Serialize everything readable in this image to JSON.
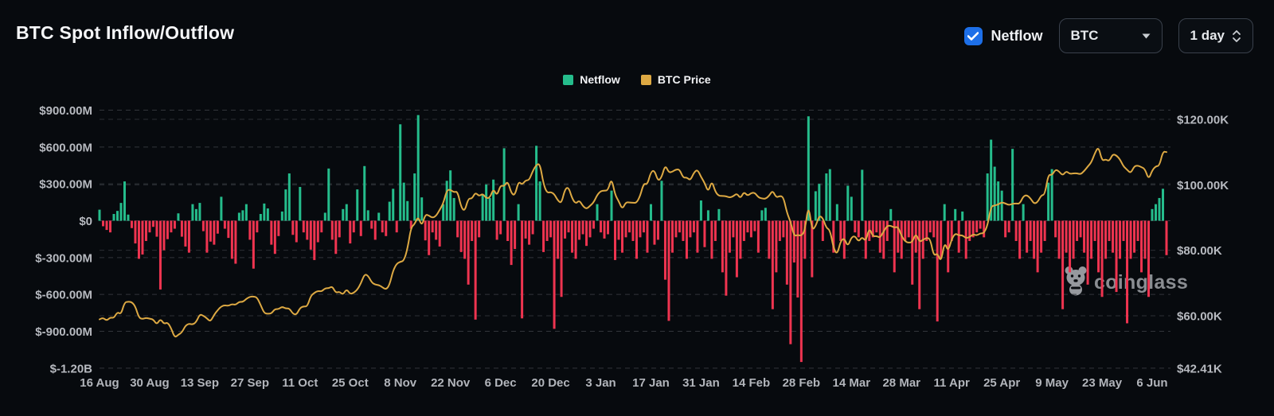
{
  "header": {
    "title": "BTC Spot Inflow/Outflow"
  },
  "controls": {
    "netflow_checkbox": {
      "label": "Netflow",
      "checked": true,
      "color": "#1d6fe8"
    },
    "coin_select": {
      "value": "BTC"
    },
    "interval_select": {
      "value": "1 day"
    }
  },
  "legend": [
    {
      "label": "Netflow",
      "color": "#25bd8c"
    },
    {
      "label": "BTC Price",
      "color": "#dda943"
    }
  ],
  "watermark": {
    "text": "coinglass"
  },
  "chart_data": {
    "type": "bar",
    "title": "BTC Spot Inflow/Outflow",
    "grid": "dashed",
    "x_tick_labels": [
      "16 Aug",
      "30 Aug",
      "13 Sep",
      "27 Sep",
      "11 Oct",
      "25 Oct",
      "8 Nov",
      "22 Nov",
      "6 Dec",
      "20 Dec",
      "3 Jan",
      "17 Jan",
      "31 Jan",
      "14 Feb",
      "28 Feb",
      "14 Mar",
      "28 Mar",
      "11 Apr",
      "25 Apr",
      "9 May",
      "23 May",
      "6 Jun"
    ],
    "x_tick_indices": [
      0,
      14,
      28,
      42,
      56,
      70,
      84,
      98,
      112,
      126,
      140,
      154,
      168,
      182,
      196,
      210,
      224,
      238,
      252,
      266,
      280,
      294
    ],
    "left_axis": {
      "title": "Netflow",
      "unit": "$M",
      "tick_labels": [
        "$900.00M",
        "$600.00M",
        "$300.00M",
        "$0",
        "$-300.00M",
        "$-600.00M",
        "$-900.00M",
        "$-1.20B"
      ],
      "tick_values": [
        900,
        600,
        300,
        0,
        -300,
        -600,
        -900,
        -1200
      ]
    },
    "right_axis": {
      "title": "BTC Price",
      "unit": "$K",
      "tick_labels": [
        "$120.00K",
        "$100.00K",
        "$80.00K",
        "$60.00K",
        "$42.41K"
      ],
      "tick_values": [
        120,
        100,
        80,
        60,
        42.41
      ]
    },
    "series": [
      {
        "name": "Netflow",
        "type": "bar",
        "axis": "left",
        "unit": "$M",
        "color_positive": "#25bd8c",
        "color_negative": "#ef3450",
        "values": [
          90,
          -45,
          -75,
          -95,
          55,
          80,
          145,
          320,
          50,
          -60,
          -185,
          -310,
          -275,
          -165,
          -95,
          -50,
          -130,
          -560,
          -240,
          -150,
          -95,
          -65,
          60,
          -130,
          -210,
          -260,
          135,
          95,
          145,
          -85,
          -260,
          -170,
          -195,
          -105,
          195,
          -65,
          -140,
          -310,
          -350,
          65,
          85,
          135,
          -155,
          -390,
          -95,
          55,
          140,
          100,
          -195,
          -270,
          -125,
          75,
          255,
          385,
          -115,
          -175,
          275,
          -95,
          -155,
          -235,
          -320,
          -175,
          -95,
          65,
          425,
          -155,
          -270,
          -135,
          95,
          135,
          -185,
          -95,
          255,
          -125,
          445,
          85,
          -65,
          -155,
          65,
          -95,
          -125,
          155,
          260,
          -95,
          785,
          310,
          160,
          -65,
          385,
          860,
          190,
          -160,
          -280,
          -95,
          -155,
          -210,
          135,
          325,
          410,
          185,
          -135,
          -255,
          -310,
          -520,
          -165,
          -805,
          -135,
          210,
          295,
          185,
          335,
          -155,
          -110,
          590,
          -165,
          -360,
          -230,
          135,
          -795,
          -145,
          -195,
          -110,
          610,
          320,
          -255,
          -165,
          -135,
          -880,
          -310,
          -620,
          -145,
          -95,
          -260,
          -310,
          -155,
          -110,
          -205,
          -135,
          -65,
          135,
          -95,
          -145,
          -110,
          245,
          -320,
          -155,
          -260,
          -135,
          -95,
          -165,
          -310,
          -135,
          -95,
          -260,
          135,
          -195,
          -155,
          325,
          -480,
          -815,
          -260,
          -135,
          -95,
          -165,
          -310,
          -135,
          -95,
          -260,
          165,
          -215,
          85,
          -310,
          -165,
          95,
          -420,
          -610,
          -260,
          -135,
          -460,
          -310,
          -165,
          -95,
          -135,
          -85,
          -260,
          85,
          105,
          -310,
          -720,
          -420,
          -165,
          -135,
          -520,
          -1005,
          -340,
          -625,
          -1150,
          -310,
          850,
          -460,
          240,
          300,
          -165,
          385,
          420,
          -260,
          135,
          -165,
          -310,
          285,
          195,
          -95,
          -135,
          415,
          -310,
          -165,
          -135,
          -95,
          -260,
          -310,
          -165,
          95,
          -420,
          -260,
          -310,
          -165,
          -135,
          -520,
          -260,
          -720,
          -310,
          -165,
          -95,
          -135,
          -820,
          -310,
          135,
          -420,
          -165,
          95,
          -260,
          75,
          -310,
          -165,
          -135,
          -95,
          -65,
          -135,
          385,
          660,
          440,
          320,
          245,
          -135,
          -95,
          585,
          -165,
          -310,
          135,
          -260,
          -165,
          -310,
          -420,
          -260,
          -165,
          310,
          420,
          -135,
          -310,
          -720,
          -260,
          -420,
          -310,
          -165,
          -135,
          -260,
          -520,
          -310,
          -165,
          -420,
          -620,
          -310,
          -165,
          -260,
          -580,
          -310,
          -165,
          -835,
          -310,
          -260,
          -165,
          -420,
          -310,
          -620,
          95,
          135,
          185,
          260,
          -280
        ]
      },
      {
        "name": "BTC Price",
        "type": "line",
        "axis": "right",
        "unit": "$K",
        "color": "#dda943",
        "values": [
          58.9,
          59.4,
          58.5,
          59.5,
          59.3,
          61.2,
          60.4,
          64.1,
          64.3,
          64.2,
          62.9,
          59.4,
          59.0,
          59.4,
          59.1,
          58.9,
          57.3,
          59.1,
          57.5,
          58.0,
          56.2,
          53.3,
          54.2,
          54.9,
          57.0,
          57.6,
          57.3,
          58.1,
          60.5,
          60.0,
          59.2,
          58.2,
          60.3,
          61.7,
          62.9,
          63.2,
          63.0,
          63.6,
          63.3,
          64.3,
          64.2,
          65.2,
          65.8,
          65.9,
          65.6,
          63.3,
          60.8,
          60.6,
          60.7,
          62.1,
          62.0,
          62.8,
          62.2,
          62.3,
          60.6,
          60.3,
          62.4,
          62.9,
          62.8,
          66.1,
          67.0,
          67.6,
          67.4,
          68.4,
          68.4,
          69.0,
          67.0,
          67.4,
          66.4,
          68.2,
          66.6,
          67.0,
          68.0,
          69.9,
          72.7,
          72.3,
          70.2,
          69.5,
          69.4,
          68.7,
          68.0,
          69.4,
          73.9,
          75.9,
          76.5,
          76.8,
          80.4,
          87.0,
          88.0,
          90.4,
          87.3,
          91.0,
          90.6,
          89.9,
          90.5,
          92.3,
          94.3,
          98.4,
          98.5,
          97.7,
          98.0,
          93.1,
          91.9,
          95.9,
          95.7,
          97.7,
          96.5,
          97.3,
          95.9,
          96.0,
          98.8,
          96.6,
          99.9,
          99.5,
          101.2,
          97.4,
          96.7,
          101.1,
          100.0,
          101.4,
          101.4,
          104.2,
          106.1,
          106.5,
          100.2,
          97.5,
          97.8,
          97.2,
          95.2,
          94.3,
          98.7,
          99.3,
          95.8,
          94.2,
          95.3,
          93.5,
          92.6,
          93.6,
          94.6,
          96.9,
          98.1,
          98.2,
          98.3,
          102.1,
          96.9,
          95.0,
          92.5,
          94.7,
          94.6,
          94.5,
          94.5,
          96.6,
          100.5,
          100.0,
          104.0,
          104.4,
          101.1,
          102.3,
          106.1,
          103.7,
          104.0,
          104.7,
          104.7,
          102.1,
          102.3,
          101.3,
          103.7,
          104.7,
          102.4,
          100.6,
          97.7,
          101.3,
          97.8,
          96.6,
          96.6,
          96.5,
          96.1,
          96.5,
          97.4,
          95.8,
          97.9,
          96.6,
          97.5,
          97.6,
          96.2,
          95.8,
          95.7,
          96.6,
          98.3,
          96.1,
          96.6,
          96.3,
          91.4,
          88.7,
          84.3,
          84.7,
          84.4,
          86.0,
          94.2,
          86.1,
          87.3,
          90.6,
          89.9,
          86.8,
          86.2,
          80.7,
          78.6,
          82.9,
          83.7,
          81.1,
          84.0,
          84.4,
          82.6,
          84.1,
          82.7,
          86.9,
          84.2,
          84.4,
          83.8,
          85.8,
          87.5,
          87.5,
          86.9,
          87.2,
          84.4,
          82.7,
          82.3,
          82.5,
          85.2,
          82.5,
          83.2,
          83.8,
          83.5,
          78.2,
          79.2,
          76.3,
          82.6,
          79.6,
          83.4,
          85.2,
          84.5,
          84.6,
          83.7,
          84.0,
          84.9,
          84.5,
          85.2,
          85.2,
          87.5,
          93.4,
          93.7,
          94.0,
          94.7,
          94.3,
          93.8,
          94.2,
          94.3,
          94.2,
          96.5,
          96.9,
          95.9,
          94.2,
          94.7,
          96.8,
          97.0,
          103.2,
          102.9,
          104.7,
          104.1,
          102.8,
          104.2,
          103.3,
          103.5,
          103.5,
          103.2,
          104.2,
          105.6,
          106.8,
          109.7,
          111.7,
          107.3,
          107.8,
          107.2,
          109.4,
          109.0,
          107.8,
          105.6,
          104.6,
          103.5,
          105.7,
          105.9,
          105.4,
          104.8,
          101.6,
          104.4,
          105.7,
          105.8,
          110.2,
          110.0
        ]
      }
    ]
  }
}
